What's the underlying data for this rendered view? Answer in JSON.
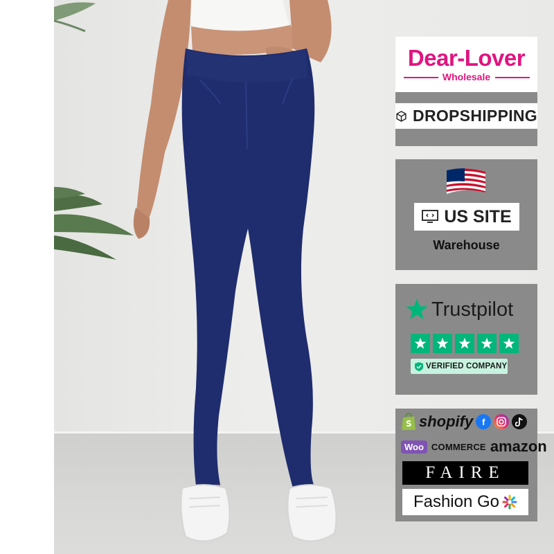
{
  "brand": {
    "name": "Dear-Lover",
    "subtitle": "Wholesale",
    "accent_color": "#e0147f"
  },
  "panels": {
    "dropshipping": {
      "label": "DROPSHIPPING",
      "icon": "box-icon"
    },
    "us_site": {
      "label": "US SITE",
      "icon": "monitor-code-icon",
      "flag": "us-flag",
      "caption": "Warehouse"
    },
    "trustpilot": {
      "label": "Trustpilot",
      "stars": 5,
      "badge": "VERIFIED COMPANY",
      "star_color": "#00b67a"
    },
    "platforms": {
      "shopify": "shopify",
      "woo": "Woo",
      "commerce": "COMMERCE",
      "amazon": "amazon",
      "faire": "FAIRE",
      "fashiongo": "Fashion Go",
      "social": [
        "facebook-icon",
        "instagram-icon",
        "tiktok-icon"
      ]
    }
  },
  "product": {
    "description": "Model wearing high-waist dark blue denim leggings with white sneakers",
    "color": "#1f2d6e"
  }
}
